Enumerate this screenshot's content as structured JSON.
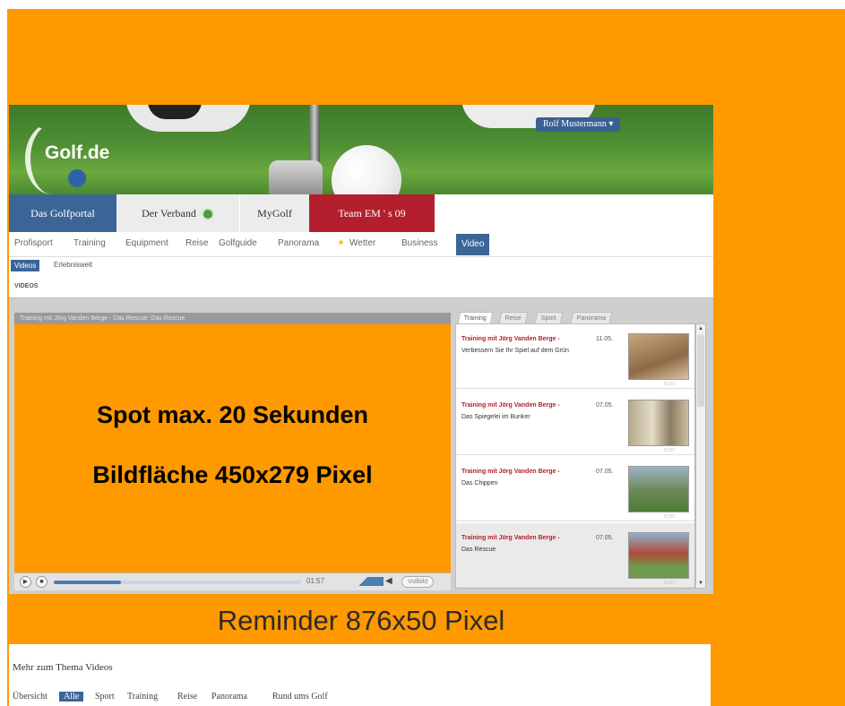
{
  "header": {
    "logo_text": "Golf.de",
    "user_button": "Rolf Mustermann ▾"
  },
  "portal_tabs": [
    {
      "label": "Das Golfportal",
      "active": true
    },
    {
      "label": "Der Verband",
      "icon": "verband-seal-icon"
    },
    {
      "label": "MyGolf"
    },
    {
      "label": "Team EM ' s 09"
    }
  ],
  "nav": {
    "items": [
      "Profisport",
      "Training",
      "Equipment",
      "Reise",
      "Golfguide",
      "Panorama",
      "Wetter",
      "Business"
    ],
    "active": "Video"
  },
  "subnav": {
    "active": "Videos",
    "item": "Erlebniswelt"
  },
  "breadcrumb": "VIDEOS",
  "player": {
    "title_bar": "Training mit Jörg Vanden Berge - Das Rescue: Das Rescue",
    "spot_line1": "Spot max. 20 Sekunden",
    "spot_line2": "Bildfläche 450x279 Pixel",
    "time": "01:57",
    "fullscreen_label": "Vollbild",
    "progress": 0.27
  },
  "playlist": {
    "tabs": [
      "Training",
      "Reise",
      "Sport",
      "Panorama"
    ],
    "items": [
      {
        "title": "Training mit Jörg Vanden Berge -",
        "date": "11.05.",
        "desc": "Verbessern Sie Ihr Spiel auf dem Grün",
        "duration": "01:57"
      },
      {
        "title": "Training mit Jörg Vanden Berge -",
        "date": "07.05.",
        "desc": "Das Spiegelei im Bunker",
        "duration": "01:57"
      },
      {
        "title": "Training mit Jörg Vanden Berge -",
        "date": "07.05.",
        "desc": "Das Chippen",
        "duration": "01:57"
      },
      {
        "title": "Training mit Jörg Vanden Berge -",
        "date": "07.05.",
        "desc": "Das Rescue",
        "duration": "01:57"
      }
    ]
  },
  "reminder": "Reminder 876x50 Pixel",
  "more_videos": {
    "title": "Mehr zum Thema Videos",
    "filters": [
      "Übersicht",
      "Alle",
      "Sport",
      "Training",
      "Reise",
      "Panorama",
      "Rund ums Golf"
    ]
  },
  "colors": {
    "orange": "#ff9900",
    "portal_blue": "#3c6597",
    "team_red": "#b41f2d"
  }
}
